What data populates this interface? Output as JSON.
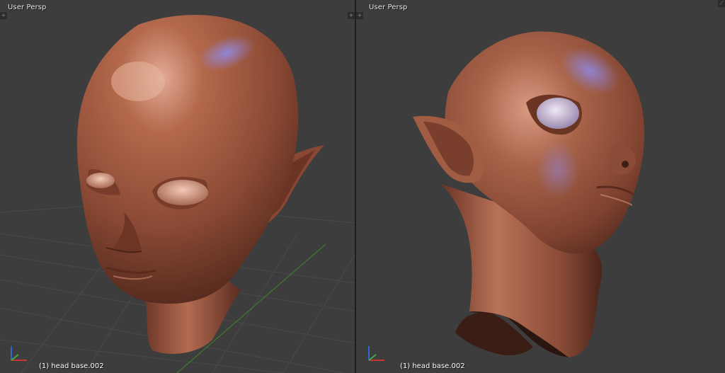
{
  "viewports": [
    {
      "title": "User Persp",
      "object_label": "(1) head base.002"
    },
    {
      "title": "User Persp",
      "object_label": "(1) head base.002"
    }
  ],
  "icons": {
    "split_handle": "plus-corner-icon",
    "axis_gizmo": "xyz-axis-gizmo-icon",
    "resize_handle": "diagonal-resize-icon"
  },
  "colors": {
    "viewport_bg": "#3d3d3d",
    "grid_line": "#4a4a4a",
    "grid_axis_y": "#3f7a2d",
    "skin_base": "#a05a40",
    "skin_highlight": "#d9a089",
    "rim_light": "#7a78d8",
    "divider": "#1e1e1e",
    "axis_x": "#cc3333",
    "axis_y": "#44aa44",
    "axis_z": "#3366cc"
  }
}
